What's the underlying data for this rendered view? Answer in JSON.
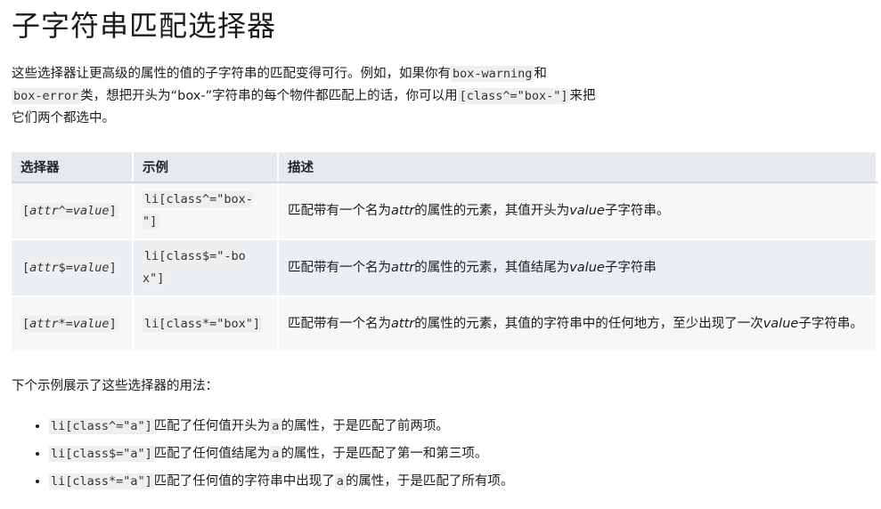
{
  "title": "子字符串匹配选择器",
  "intro": {
    "t1": "这些选择器让更高级的属性的值的子字符串的匹配变得可行。例如，如果你有",
    "c1": "box-warning",
    "t2": "和",
    "c2": "box-error",
    "t3": "类，想把开头为“box-”字符串的每个物件都匹配上的话，你可以用",
    "c3": "[class^=\"box-\"]",
    "t4": "来把它们两个都选中。"
  },
  "table": {
    "headers": [
      "选择器",
      "示例",
      "描述"
    ],
    "rows": [
      {
        "sel_open": "[",
        "sel_attr": "attr",
        "sel_op": "^=",
        "sel_val": "value",
        "sel_close": "]",
        "example": "li[class^=\"box-\"]",
        "d1": "匹配带有一个名为",
        "d_attr": "attr",
        "d2": "的属性的元素，其值开头为",
        "d_val": "value",
        "d3": "子字符串。"
      },
      {
        "sel_open": "[",
        "sel_attr": "attr",
        "sel_op": "$=",
        "sel_val": "value",
        "sel_close": "]",
        "example": "li[class$=\"-box\"]",
        "d1": "匹配带有一个名为",
        "d_attr": "attr",
        "d2": "的属性的元素，其值结尾为",
        "d_val": "value",
        "d3": "子字符串"
      },
      {
        "sel_open": "[",
        "sel_attr": "attr",
        "sel_op": "*=",
        "sel_val": "value",
        "sel_close": "]",
        "example": "li[class*=\"box\"]",
        "d1": "匹配带有一个名为",
        "d_attr": "attr",
        "d2": "的属性的元素，其值的字符串中的任何地方，至少出现了一次",
        "d_val": "value",
        "d3": "子字符串。"
      }
    ]
  },
  "below_text": "下个示例展示了这些选择器的用法：",
  "list": [
    {
      "code": "li[class^=\"a\"]",
      "t1": "匹配了任何值开头为",
      "c2": "a",
      "t2": "的属性，于是匹配了前两项。"
    },
    {
      "code": "li[class$=\"a\"]",
      "t1": "匹配了任何值结尾为",
      "c2": "a",
      "t2": "的属性，于是匹配了第一和第三项。"
    },
    {
      "code": "li[class*=\"a\"]",
      "t1": "匹配了任何值的字符串中出现了",
      "c2": "a",
      "t2": "的属性，于是匹配了所有项。"
    }
  ]
}
